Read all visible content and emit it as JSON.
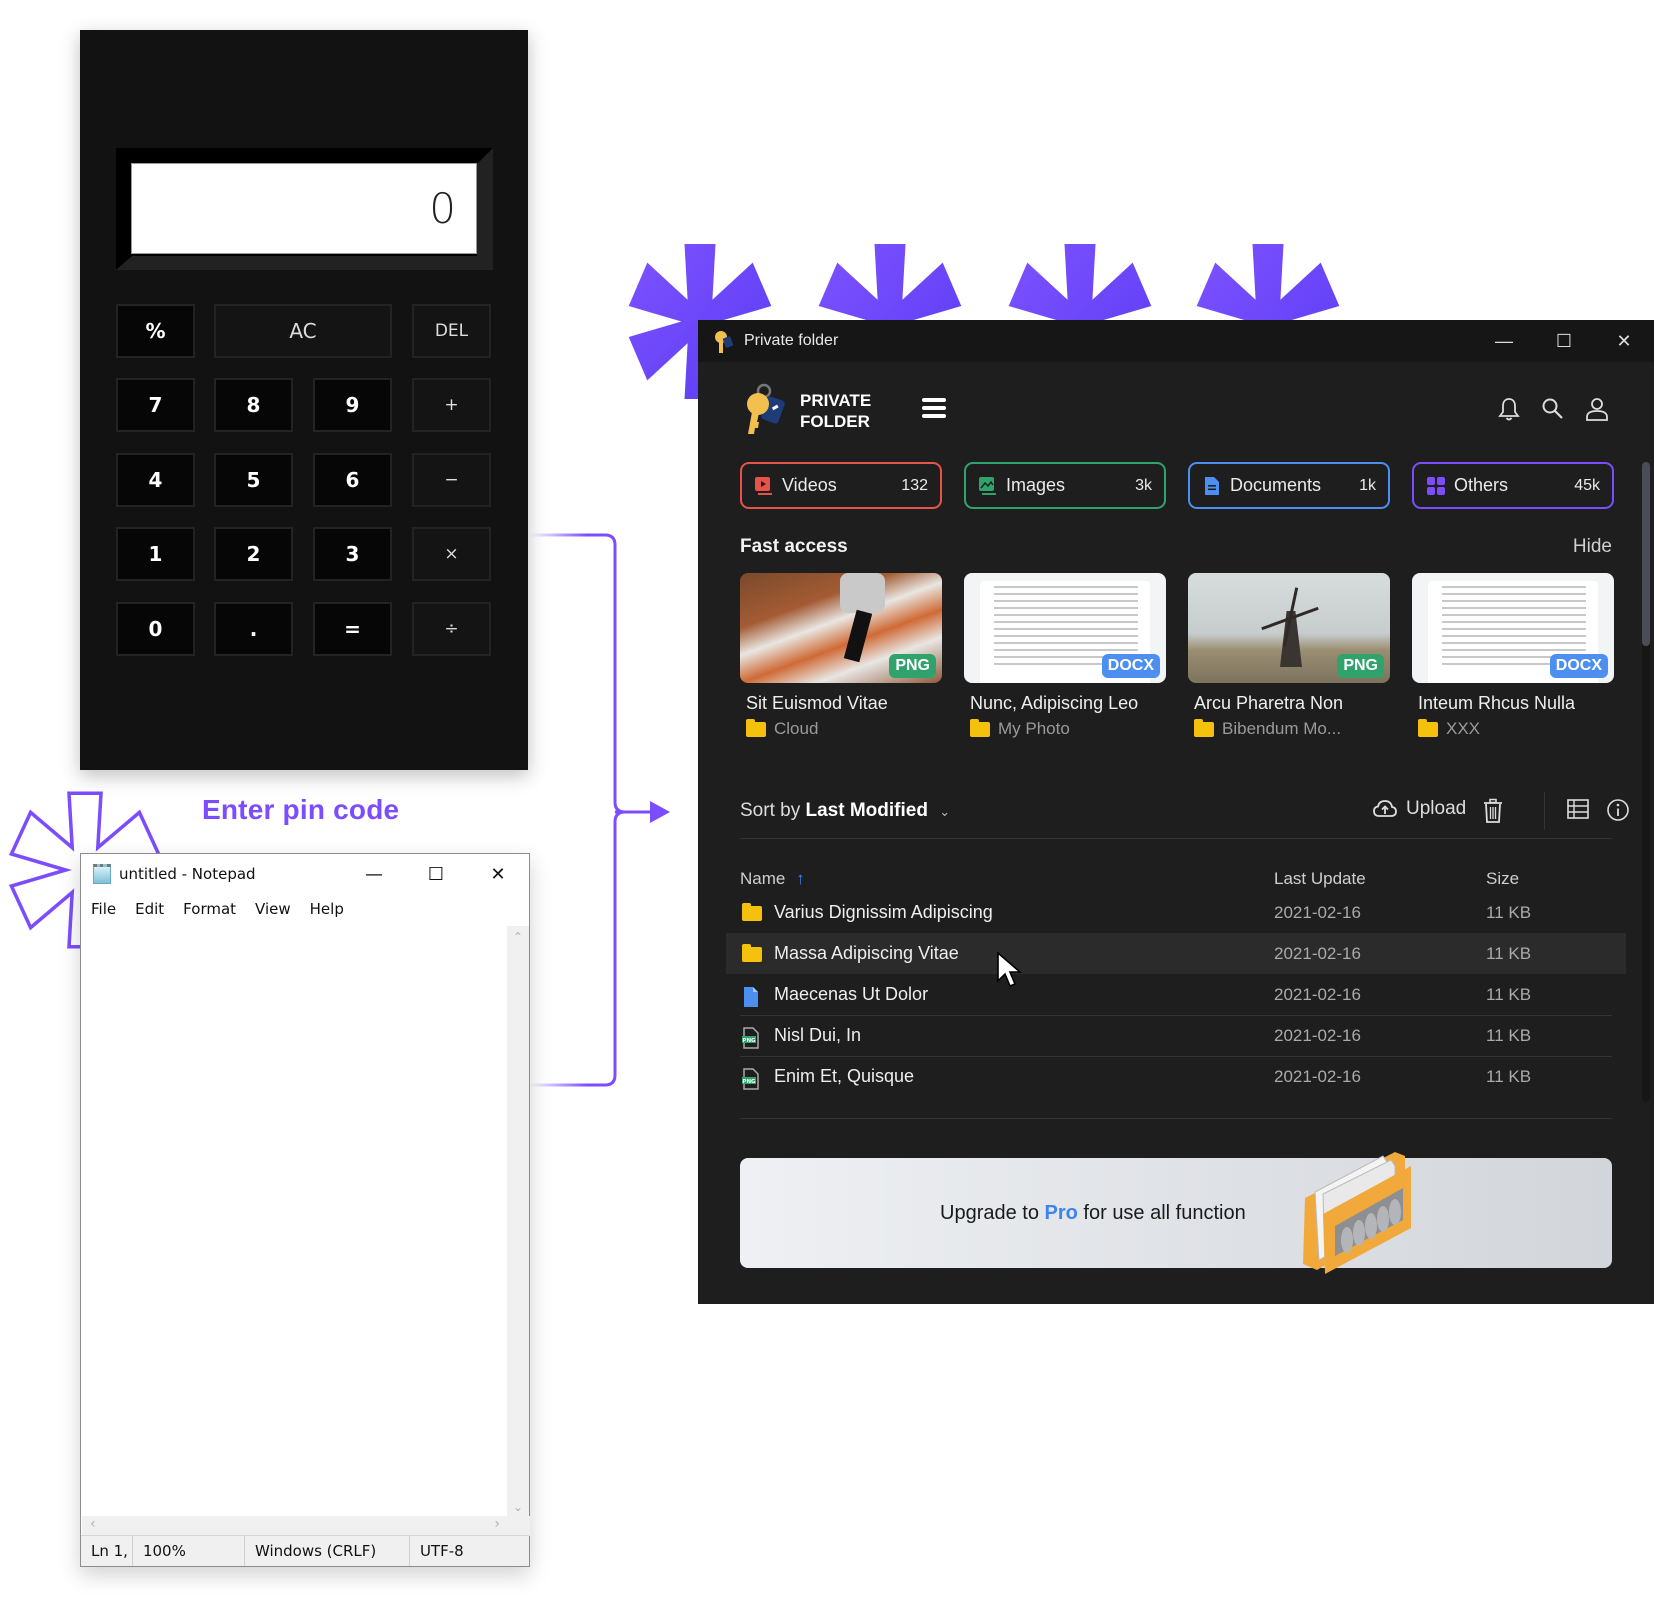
{
  "calculator": {
    "display": "0",
    "buttons": [
      {
        "label": "%",
        "kind": "num"
      },
      {
        "label": "AC",
        "kind": "wide"
      },
      {
        "label": "DEL",
        "kind": "op"
      },
      {
        "label": "7",
        "kind": "num"
      },
      {
        "label": "8",
        "kind": "num"
      },
      {
        "label": "9",
        "kind": "num"
      },
      {
        "label": "+",
        "kind": "op"
      },
      {
        "label": "4",
        "kind": "num"
      },
      {
        "label": "5",
        "kind": "num"
      },
      {
        "label": "6",
        "kind": "num"
      },
      {
        "label": "−",
        "kind": "op"
      },
      {
        "label": "1",
        "kind": "num"
      },
      {
        "label": "2",
        "kind": "num"
      },
      {
        "label": "3",
        "kind": "num"
      },
      {
        "label": "×",
        "kind": "op"
      },
      {
        "label": "0",
        "kind": "num"
      },
      {
        "label": ".",
        "kind": "num"
      },
      {
        "label": "=",
        "kind": "num"
      },
      {
        "label": "÷",
        "kind": "op"
      }
    ]
  },
  "pin_label": "Enter pin code",
  "notepad": {
    "title": "untitled - Notepad",
    "window_controls": {
      "minimize": "—",
      "maximize": "☐",
      "close": "✕"
    },
    "menu": [
      "File",
      "Edit",
      "Format",
      "View",
      "Help"
    ],
    "content": "",
    "status": {
      "position": "Ln 1,",
      "zoom": "100%",
      "line_ending": "Windows (CRLF)",
      "encoding": "UTF-8"
    }
  },
  "private_folder": {
    "window_title": "Private folder",
    "window_controls": {
      "minimize": "—",
      "maximize": "☐",
      "close": "✕"
    },
    "brand_line1": "PRIVATE",
    "brand_line2": "FOLDER",
    "header_icons": [
      "bell-icon",
      "search-icon",
      "user-icon"
    ],
    "categories": [
      {
        "name": "Videos",
        "count": "132",
        "color": "#e5534b",
        "icon": "video-icon"
      },
      {
        "name": "Images",
        "count": "3k",
        "color": "#2fa36b",
        "icon": "image-icon"
      },
      {
        "name": "Documents",
        "count": "1k",
        "color": "#4d8ff0",
        "icon": "document-icon"
      },
      {
        "name": "Others",
        "count": "45k",
        "color": "#7b4dff",
        "icon": "grid-icon"
      }
    ],
    "fast_access": {
      "title": "Fast access",
      "hide_label": "Hide",
      "items": [
        {
          "name": "Sit Euismod Vitae",
          "folder": "Cloud",
          "badge": "PNG",
          "badge_color": "#2fa36b",
          "thumb": "photo-scooter"
        },
        {
          "name": "Nunc, Adipiscing Leo",
          "folder": "My Photo",
          "badge": "DOCX",
          "badge_color": "#4d8ff0",
          "thumb": "document"
        },
        {
          "name": "Arcu Pharetra Non",
          "folder": "Bibendum Mo...",
          "badge": "PNG",
          "badge_color": "#2fa36b",
          "thumb": "photo-windmill"
        },
        {
          "name": "Inteum Rhcus Nulla",
          "folder": "XXX",
          "badge": "DOCX",
          "badge_color": "#4d8ff0",
          "thumb": "document"
        }
      ]
    },
    "sort": {
      "prefix": "Sort by",
      "value": "Last Modified"
    },
    "toolbar": {
      "upload_label": "Upload"
    },
    "table": {
      "columns": {
        "name": "Name",
        "last_update": "Last Update",
        "size": "Size"
      },
      "rows": [
        {
          "name": "Varius Dignissim Adipiscing",
          "date": "2021-02-16",
          "size": "11 KB",
          "type": "folder"
        },
        {
          "name": "Massa Adipiscing Vitae",
          "date": "2021-02-16",
          "size": "11 KB",
          "type": "folder",
          "hovered": true
        },
        {
          "name": "Maecenas Ut Dolor",
          "date": "2021-02-16",
          "size": "11 KB",
          "type": "document"
        },
        {
          "name": "Nisl Dui, In",
          "date": "2021-02-16",
          "size": "11 KB",
          "type": "png"
        },
        {
          "name": "Enim Et, Quisque",
          "date": "2021-02-16",
          "size": "11 KB",
          "type": "png"
        }
      ]
    },
    "promo": {
      "before": "Upgrade to ",
      "highlight": "Pro",
      "after": " for use all function"
    }
  },
  "colors": {
    "accent_purple": "#7b4dff",
    "pro_blue": "#3d84f0",
    "folder_yellow": "#f4c20d"
  }
}
